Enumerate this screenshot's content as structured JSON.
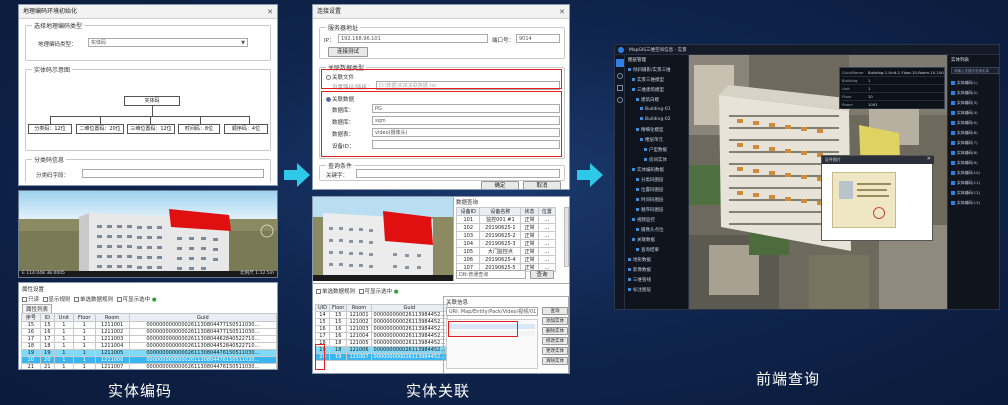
{
  "captions": {
    "entity_encoding": "实体编码",
    "entity_association": "实体关联",
    "frontend_query": "前端查询"
  },
  "panel1": {
    "dialog": {
      "title": "地理编码环境初始化",
      "group1_label": "选择地理编码类型",
      "type_label": "地理编码类型：",
      "type_value": "实体码",
      "group2_label": "实体码示意图",
      "root_node": "实体码",
      "child_nodes": [
        "分类码：12位",
        "二维位置码：20位",
        "三维位置码：12位",
        "时间码：8位",
        "顺序码：4位"
      ],
      "group3_label": "分类码信息",
      "field_label": "分类码字段："
    },
    "scene": {
      "status_left": "E 114.048 38.0005",
      "status_right": "比例尺 1:12.5m"
    },
    "attr_panel": {
      "title": "属性设置",
      "options": [
        "只读",
        "显示规则",
        "单选数据规则",
        "可显示选中"
      ],
      "tab": "属性列表",
      "columns": [
        "序号",
        "ID",
        "Unit",
        "Floor",
        "Room",
        "Guid"
      ],
      "rows": [
        [
          "15",
          "15",
          "1",
          "1",
          "1211001",
          "0000000000000261130804477150511030..."
        ],
        [
          "16",
          "16",
          "1",
          "1",
          "1211002",
          "0000000000000261130804477150511030..."
        ],
        [
          "17",
          "17",
          "1",
          "1",
          "1211003",
          "0000000000000261130804462840522710..."
        ],
        [
          "18",
          "18",
          "1",
          "1",
          "1211004",
          "0000000000000261130804452840522710..."
        ],
        [
          "19",
          "19",
          "1",
          "1",
          "1211005",
          "0000000000000261130804476150511030..."
        ],
        [
          "20",
          "20",
          "1",
          "1",
          "1211006",
          "0000000000000261130804476150511030..."
        ],
        [
          "21",
          "21",
          "1",
          "1",
          "1211007",
          "0000000000000261130804476150511030..."
        ]
      ]
    }
  },
  "panel2": {
    "dialog": {
      "title": "连接设置",
      "server_group": "服务器地址",
      "ip_label": "IP：",
      "ip_value": "192.168.96.101",
      "port_label": "端口号：",
      "port_value": "9014",
      "test_button": "连接测试",
      "assoc_group": "关联数据类型",
      "file_option": "关联文件",
      "file_label": "设置路径/链接：",
      "file_value": "D:\\数据\\实体关联数据.txt",
      "db_option": "关联数据",
      "db_type_label": "数据库：",
      "db_type_value": "PG",
      "db_user_label": "数据库：",
      "db_user_value": "sqm",
      "db_table_label": "数据表：",
      "db_table_value": "video(摄像头)",
      "device_label": "设备ID：",
      "query_group": "查询条件",
      "keyword_label": "关键字：",
      "ok_button": "确定",
      "cancel_button": "取消"
    },
    "side_table": {
      "title": "数据查询",
      "columns": [
        "设备ID",
        "设备名称",
        "状态",
        "位置"
      ],
      "rows": [
        [
          "101",
          "监控001 #1",
          "正常",
          "..."
        ],
        [
          "102",
          "20190625-1",
          "正常",
          "..."
        ],
        [
          "103",
          "20190625-2",
          "正常",
          "..."
        ],
        [
          "104",
          "20190625-3",
          "正常",
          "..."
        ],
        [
          "105",
          "大门监控点",
          "正常",
          "..."
        ],
        [
          "106",
          "20190625-4",
          "正常",
          "..."
        ],
        [
          "107",
          "20190625-5",
          "正常",
          "..."
        ]
      ],
      "filter_label": "DN:普通查询",
      "filter_button": "查询"
    },
    "attr_panel": {
      "options": [
        "单选数据规则",
        "可显示选中"
      ],
      "columns": [
        "UID",
        "Floor",
        "Room",
        "Guid"
      ],
      "rows": [
        [
          "14",
          "15",
          "121001",
          "000000000026113984452..."
        ],
        [
          "15",
          "15",
          "121002",
          "000000000026113984452..."
        ],
        [
          "16",
          "16",
          "121003",
          "000000000026113984452..."
        ],
        [
          "17",
          "16",
          "121004",
          "000000000026113984452..."
        ],
        [
          "18",
          "18",
          "121005",
          "000000000026113984452..."
        ],
        [
          "19",
          "18",
          "121006",
          "000000000026113984452..."
        ],
        [
          "20",
          "19",
          "121007",
          "000000000026113984452..."
        ]
      ],
      "assoc_title": "关联信息",
      "assoc_path": "URI: Map/Entity/Pack/Video/视频/01",
      "assoc_buttons": [
        "查询",
        "添加实体",
        "删除实体",
        "修改实体",
        "更改实体",
        "清除实体"
      ]
    }
  },
  "panel3": {
    "app_title": "MapGIS三维空间信息 - 实景",
    "tree_title": "图层管理",
    "tree_items": [
      "倾斜摄影/实景三维",
      "实景三维模型",
      "三维建筑模型",
      "建筑白模",
      "Building-01",
      "Building-02",
      "精细化模型",
      "楼层单元",
      "户型数据",
      "房间实体",
      "实体编码数据",
      "分类码图层",
      "位置码图层",
      "时间码图层",
      "顺序码图层",
      "视频监控",
      "摄像头点位",
      "关联数据",
      "查询结果",
      "地形数据",
      "影像数据",
      "三维管线",
      "标注图层"
    ],
    "popup": {
      "rows": [
        [
          "Guid/Name",
          "Building-1-Unit-1-Floor-10-Room-10-1001"
        ],
        [
          "Building",
          "1"
        ],
        [
          "Unit",
          "1"
        ],
        [
          "Floor",
          "10"
        ],
        [
          "Room",
          "1001"
        ]
      ]
    },
    "doc_title": "证件照片",
    "right_title": "实体列表",
    "right_search": "请输入关键字查询实体",
    "right_items": [
      "实体编码(1)",
      "实体编码(2)",
      "实体编码(3)",
      "实体编码(4)",
      "实体编码(5)",
      "实体编码(6)",
      "实体编码(7)",
      "实体编码(8)",
      "实体编码(9)",
      "实体编码(10)",
      "实体编码(11)",
      "实体编码(12)",
      "实体编码(13)"
    ]
  }
}
